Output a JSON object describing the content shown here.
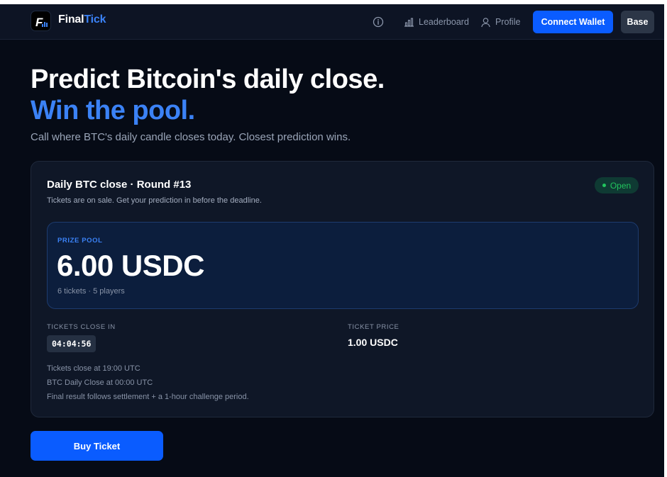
{
  "header": {
    "brand_primary": "Final",
    "brand_accent": "Tick",
    "logo_letter": "F",
    "nav": {
      "info_icon": "info-circle-icon",
      "leaderboard_label": "Leaderboard",
      "leaderboard_icon": "bar-chart-icon",
      "profile_label": "Profile",
      "profile_icon": "user-icon"
    },
    "connect_wallet_label": "Connect Wallet",
    "network_label": "Base"
  },
  "hero": {
    "headline": "Predict Bitcoin's daily close.",
    "headline_accent": "Win the pool.",
    "subtitle": "Call where BTC's daily candle closes today. Closest prediction wins."
  },
  "round": {
    "title": "Daily BTC close · Round #13",
    "description": "Tickets are on sale. Get your prediction in before the deadline.",
    "status": "Open",
    "prize_pool": {
      "label": "PRIZE POOL",
      "value": "6.00 USDC",
      "details": "6 tickets · 5 players"
    },
    "tickets_close_in": {
      "label": "TICKETS CLOSE IN",
      "countdown": "04:04:56"
    },
    "ticket_price": {
      "label": "TICKET PRICE",
      "value": "1.00 USDC"
    },
    "notes": [
      "Tickets close at 19:00 UTC",
      "BTC Daily Close at 00:00 UTC",
      "Final result follows settlement + a 1-hour challenge period."
    ]
  },
  "buy_button_label": "Buy Ticket",
  "colors": {
    "background": "#060b16",
    "accent_blue": "#3b82f6",
    "button_blue": "#0a5cff",
    "status_green": "#22c55e"
  }
}
